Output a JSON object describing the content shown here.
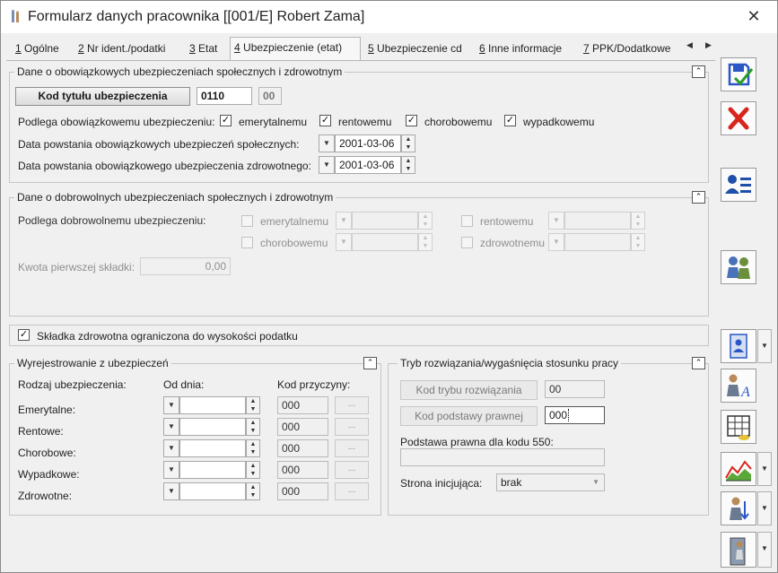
{
  "window": {
    "title": "Formularz danych pracownika [[001/E] Robert Zama]",
    "close_glyph": "✕"
  },
  "tabs": [
    {
      "num": "1",
      "label": "Ogólne"
    },
    {
      "num": "2",
      "label": "Nr ident./podatki"
    },
    {
      "num": "3",
      "label": "Etat"
    },
    {
      "num": "4",
      "label": "Ubezpieczenie (etat)"
    },
    {
      "num": "5",
      "label": "Ubezpieczenie cd"
    },
    {
      "num": "6",
      "label": "Inne informacje"
    },
    {
      "num": "7",
      "label": "PPK/Dodatkowe"
    }
  ],
  "mandatory": {
    "legend": "Dane o obowiązkowych ubezpieczeniach społecznych i zdrowotnym",
    "code_button": "Kod tytułu ubezpieczenia",
    "code_value": "0110",
    "code_suffix": "00",
    "subject_label": "Podlega obowiązkowemu ubezpieczeniu:",
    "checks": [
      {
        "label": "emerytalnemu",
        "checked": true
      },
      {
        "label": "rentowemu",
        "checked": true
      },
      {
        "label": "chorobowemu",
        "checked": true
      },
      {
        "label": "wypadkowemu",
        "checked": true
      }
    ],
    "social_date_label": "Data powstania obowiązkowych ubezpieczeń społecznych:",
    "social_date": "2001-03-06",
    "health_date_label": "Data powstania obowiązkowego ubezpieczenia zdrowotnego:",
    "health_date": "2001-03-06"
  },
  "voluntary": {
    "legend": "Dane o dobrowolnych ubezpieczeniach społecznych i zdrowotnym",
    "subject_label": "Podlega dobrowolnemu ubezpieczeniu:",
    "checks": [
      {
        "label": "emerytalnemu"
      },
      {
        "label": "rentowemu"
      },
      {
        "label": "chorobowemu"
      },
      {
        "label": "zdrowotnemu"
      }
    ],
    "first_fee_label": "Kwota pierwszej składki:",
    "first_fee_value": "0,00"
  },
  "health_limit": {
    "label": "Składka zdrowotna ograniczona do wysokości podatku",
    "checked": true
  },
  "deregistration": {
    "legend": "Wyrejestrowanie z ubezpieczeń",
    "col_type": "Rodzaj ubezpieczenia:",
    "col_from": "Od dnia:",
    "col_reason": "Kod przyczyny:",
    "rows": [
      {
        "label": "Emerytalne:",
        "date": "",
        "code": "000"
      },
      {
        "label": "Rentowe:",
        "date": "",
        "code": "000"
      },
      {
        "label": "Chorobowe:",
        "date": "",
        "code": "000"
      },
      {
        "label": "Wypadkowe:",
        "date": "",
        "code": "000"
      },
      {
        "label": "Zdrowotne:",
        "date": "",
        "code": "000"
      }
    ],
    "dots": "..."
  },
  "termination": {
    "legend": "Tryb rozwiązania/wygaśnięcia stosunku pracy",
    "mode_button": "Kod trybu rozwiązania",
    "mode_value": "00",
    "basis_button": "Kod podstawy prawnej",
    "basis_value": "000",
    "legal_basis_label": "Podstawa prawna dla kodu 550:",
    "legal_basis_value": "",
    "initiator_label": "Strona inicjująca:",
    "initiator_value": "brak"
  },
  "colors": {
    "save": "#2a56c6",
    "cancel": "#d8261c",
    "accent": "#1f4fa8"
  }
}
